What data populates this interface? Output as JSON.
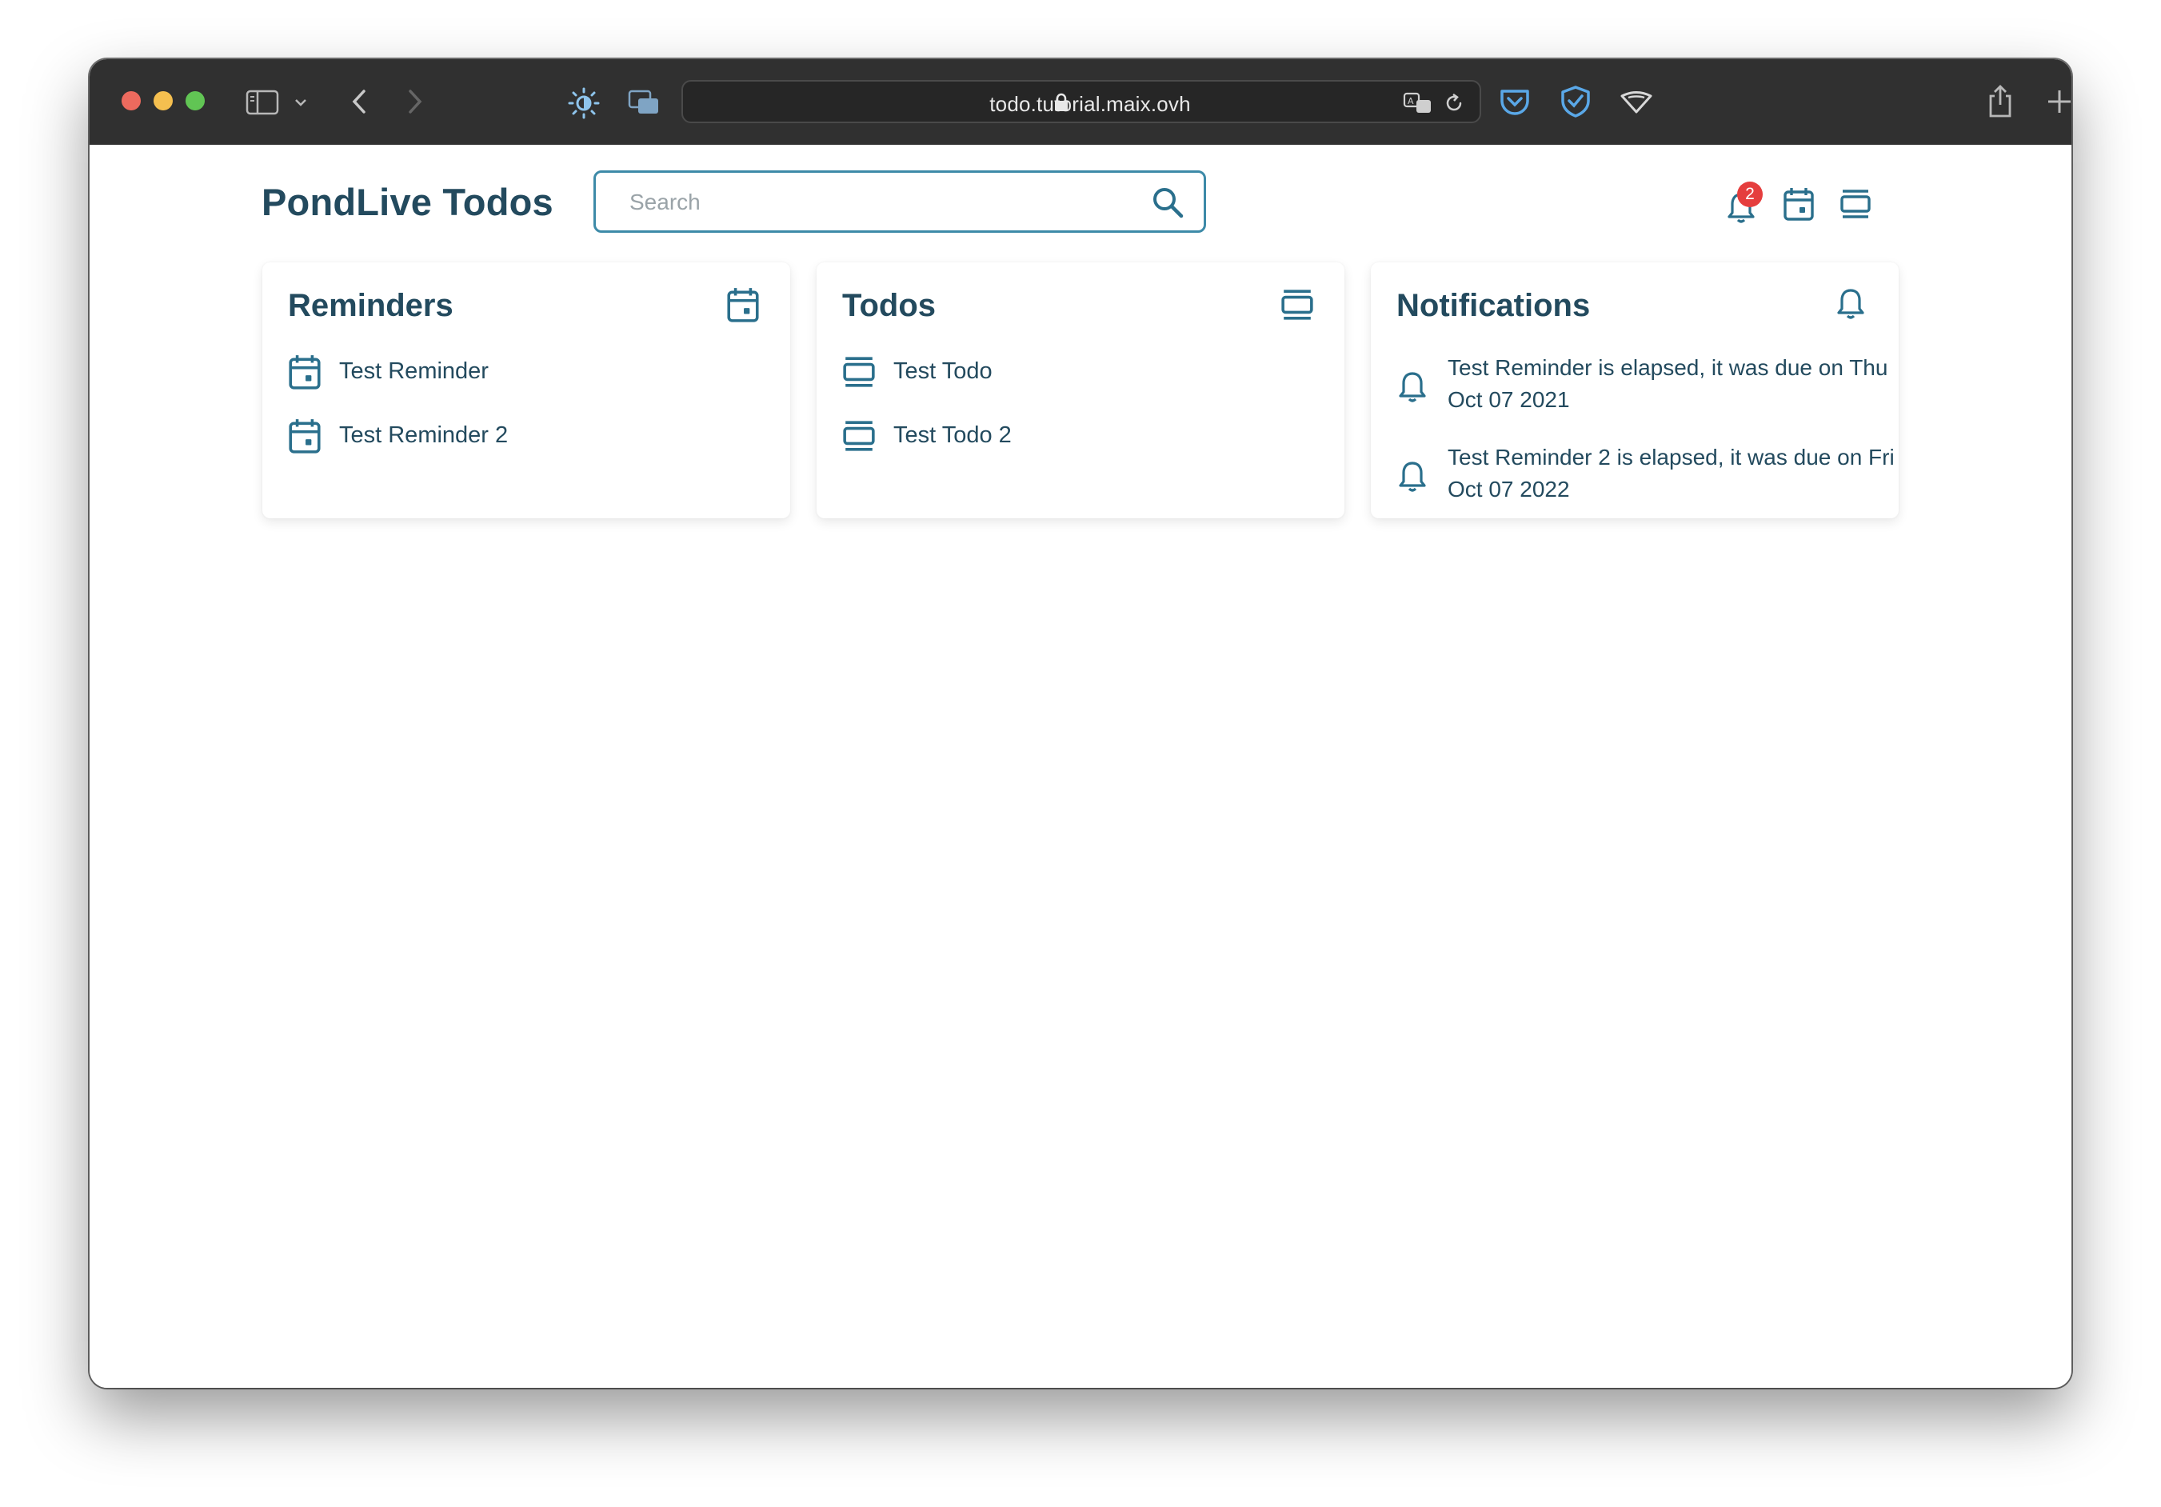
{
  "browser": {
    "url": "todo.tutorial.maix.ovh"
  },
  "app": {
    "title": "PondLive Todos",
    "search": {
      "placeholder": "Search",
      "value": ""
    },
    "notification_count": "2"
  },
  "reminders": {
    "title": "Reminders",
    "items": [
      {
        "label": "Test Reminder"
      },
      {
        "label": "Test Reminder 2"
      }
    ]
  },
  "todos": {
    "title": "Todos",
    "items": [
      {
        "label": "Test Todo"
      },
      {
        "label": "Test Todo 2"
      }
    ]
  },
  "notifications": {
    "title": "Notifications",
    "items": [
      {
        "text": "Test Reminder is elapsed, it was due on Thu Oct 07 2021"
      },
      {
        "text": "Test Reminder 2 is elapsed, it was due on Fri Oct 07 2022"
      }
    ]
  },
  "colors": {
    "primary": "#234a5e",
    "icon": "#2a6f8c",
    "search_border": "#3d8aa8",
    "badge": "#e53e3e",
    "browser_chrome": "#303030"
  },
  "icons": {
    "reminder": "calendar-icon",
    "todo": "todo-box-icon",
    "notification": "bell-icon"
  }
}
